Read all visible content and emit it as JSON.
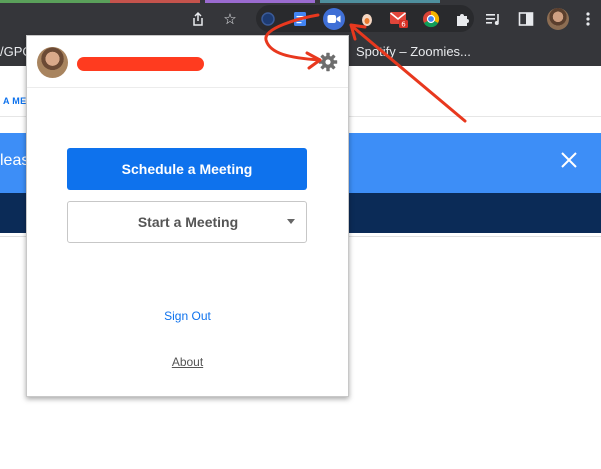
{
  "browser": {
    "extension_badge": "6",
    "bookmarks": [
      "/GPO",
      "Spotify – Zoomies..."
    ],
    "icons": [
      "share-icon",
      "star-icon",
      "extension-dot-icon",
      "google-docs-icon",
      "zoom-icon",
      "extension-icon",
      "gmail-icon",
      "chrome-extension-icon",
      "puzzle-icon",
      "media-queue-icon",
      "sidebar-icon",
      "profile-avatar-icon"
    ]
  },
  "page": {
    "link_text": "A ME",
    "banner_text": "leas",
    "banner_color": "#3d8ef7",
    "navy_color": "#0b2b57"
  },
  "popup": {
    "schedule_label": "Schedule a Meeting",
    "start_label": "Start a Meeting",
    "signout_label": "Sign Out",
    "about_label": "About",
    "accent_color": "#0e72ed",
    "redaction_color": "#ff3b1f"
  }
}
